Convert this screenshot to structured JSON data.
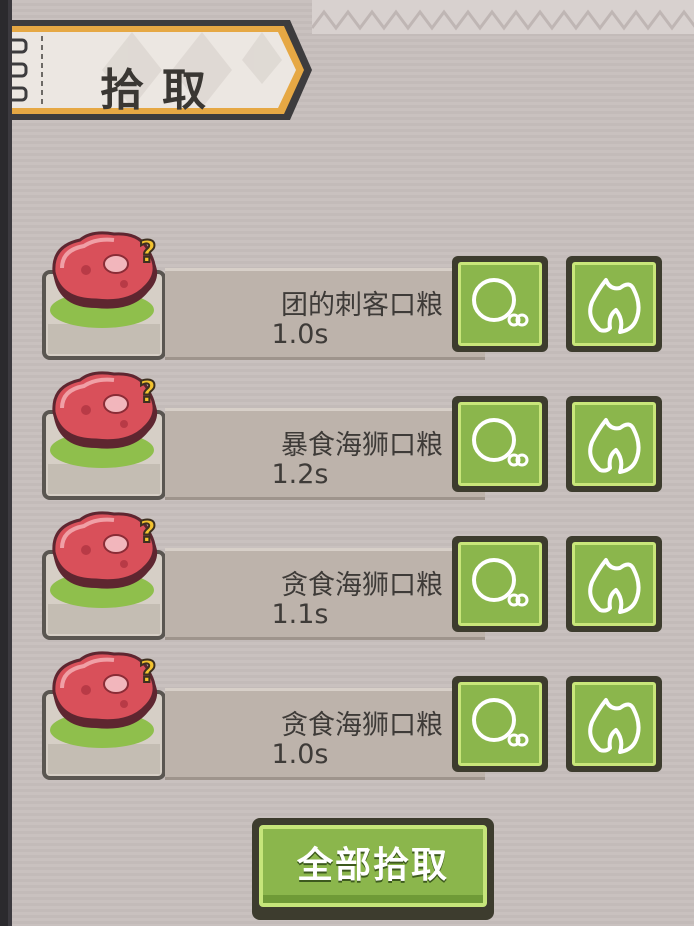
{
  "header": {
    "title": "拾取"
  },
  "items": [
    {
      "name": "团的刺客口粮",
      "time": "1.0s",
      "icon": "meat-icon",
      "badge": "?"
    },
    {
      "name": "暴食海狮口粮",
      "time": "1.2s",
      "icon": "meat-icon",
      "badge": "?"
    },
    {
      "name": "贪食海狮口粮",
      "time": "1.1s",
      "icon": "meat-icon",
      "badge": "?"
    },
    {
      "name": "贪食海狮口粮",
      "time": "1.0s",
      "icon": "meat-icon",
      "badge": "?"
    }
  ],
  "actions": {
    "eat_icon": "eat-mouth-icon",
    "fire_icon": "fire-icon"
  },
  "footer": {
    "collect_all_label": "全部拾取"
  },
  "colors": {
    "panel": "#c9c1bf",
    "button_green": "#8bb64c",
    "meat_red": "#d9505a",
    "badge_yellow": "#f2c230"
  }
}
